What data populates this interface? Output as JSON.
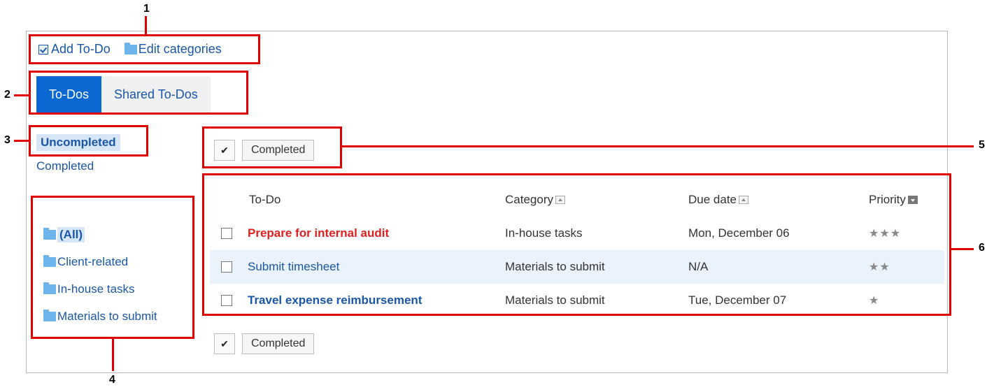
{
  "callouts": {
    "n1": "1",
    "n2": "2",
    "n3": "3",
    "n4": "4",
    "n5": "5",
    "n6": "6"
  },
  "toolbar": {
    "add_todo": "Add To-Do",
    "edit_categories": "Edit categories"
  },
  "tabs": [
    {
      "label": "To-Dos",
      "active": true
    },
    {
      "label": "Shared To-Dos",
      "active": false
    }
  ],
  "status_filter": {
    "selected": "Uncompleted",
    "other": "Completed"
  },
  "categories": [
    {
      "label": "(All)",
      "selected": true
    },
    {
      "label": "Client-related",
      "selected": false
    },
    {
      "label": "In-house tasks",
      "selected": false
    },
    {
      "label": "Materials to submit",
      "selected": false
    }
  ],
  "actions": {
    "check_glyph": "✔",
    "completed_label": "Completed"
  },
  "table": {
    "columns": [
      "To-Do",
      "Category",
      "Due date",
      "Priority"
    ],
    "rows": [
      {
        "todo": "Prepare for internal audit",
        "category": "In-house tasks",
        "due": "Mon, December 06",
        "priority": "★★★",
        "priority_level": 3
      },
      {
        "todo": "Submit timesheet",
        "category": "Materials to submit",
        "due": "N/A",
        "priority": "★★",
        "priority_level": 2
      },
      {
        "todo": "Travel expense reimbursement",
        "category": "Materials to submit",
        "due": "Tue, December 07",
        "priority": "★",
        "priority_level": 1
      }
    ]
  },
  "colors": {
    "accent": "#0b68d3",
    "link": "#1a57a6",
    "overdue": "#e02020",
    "callout": "#e00000"
  }
}
